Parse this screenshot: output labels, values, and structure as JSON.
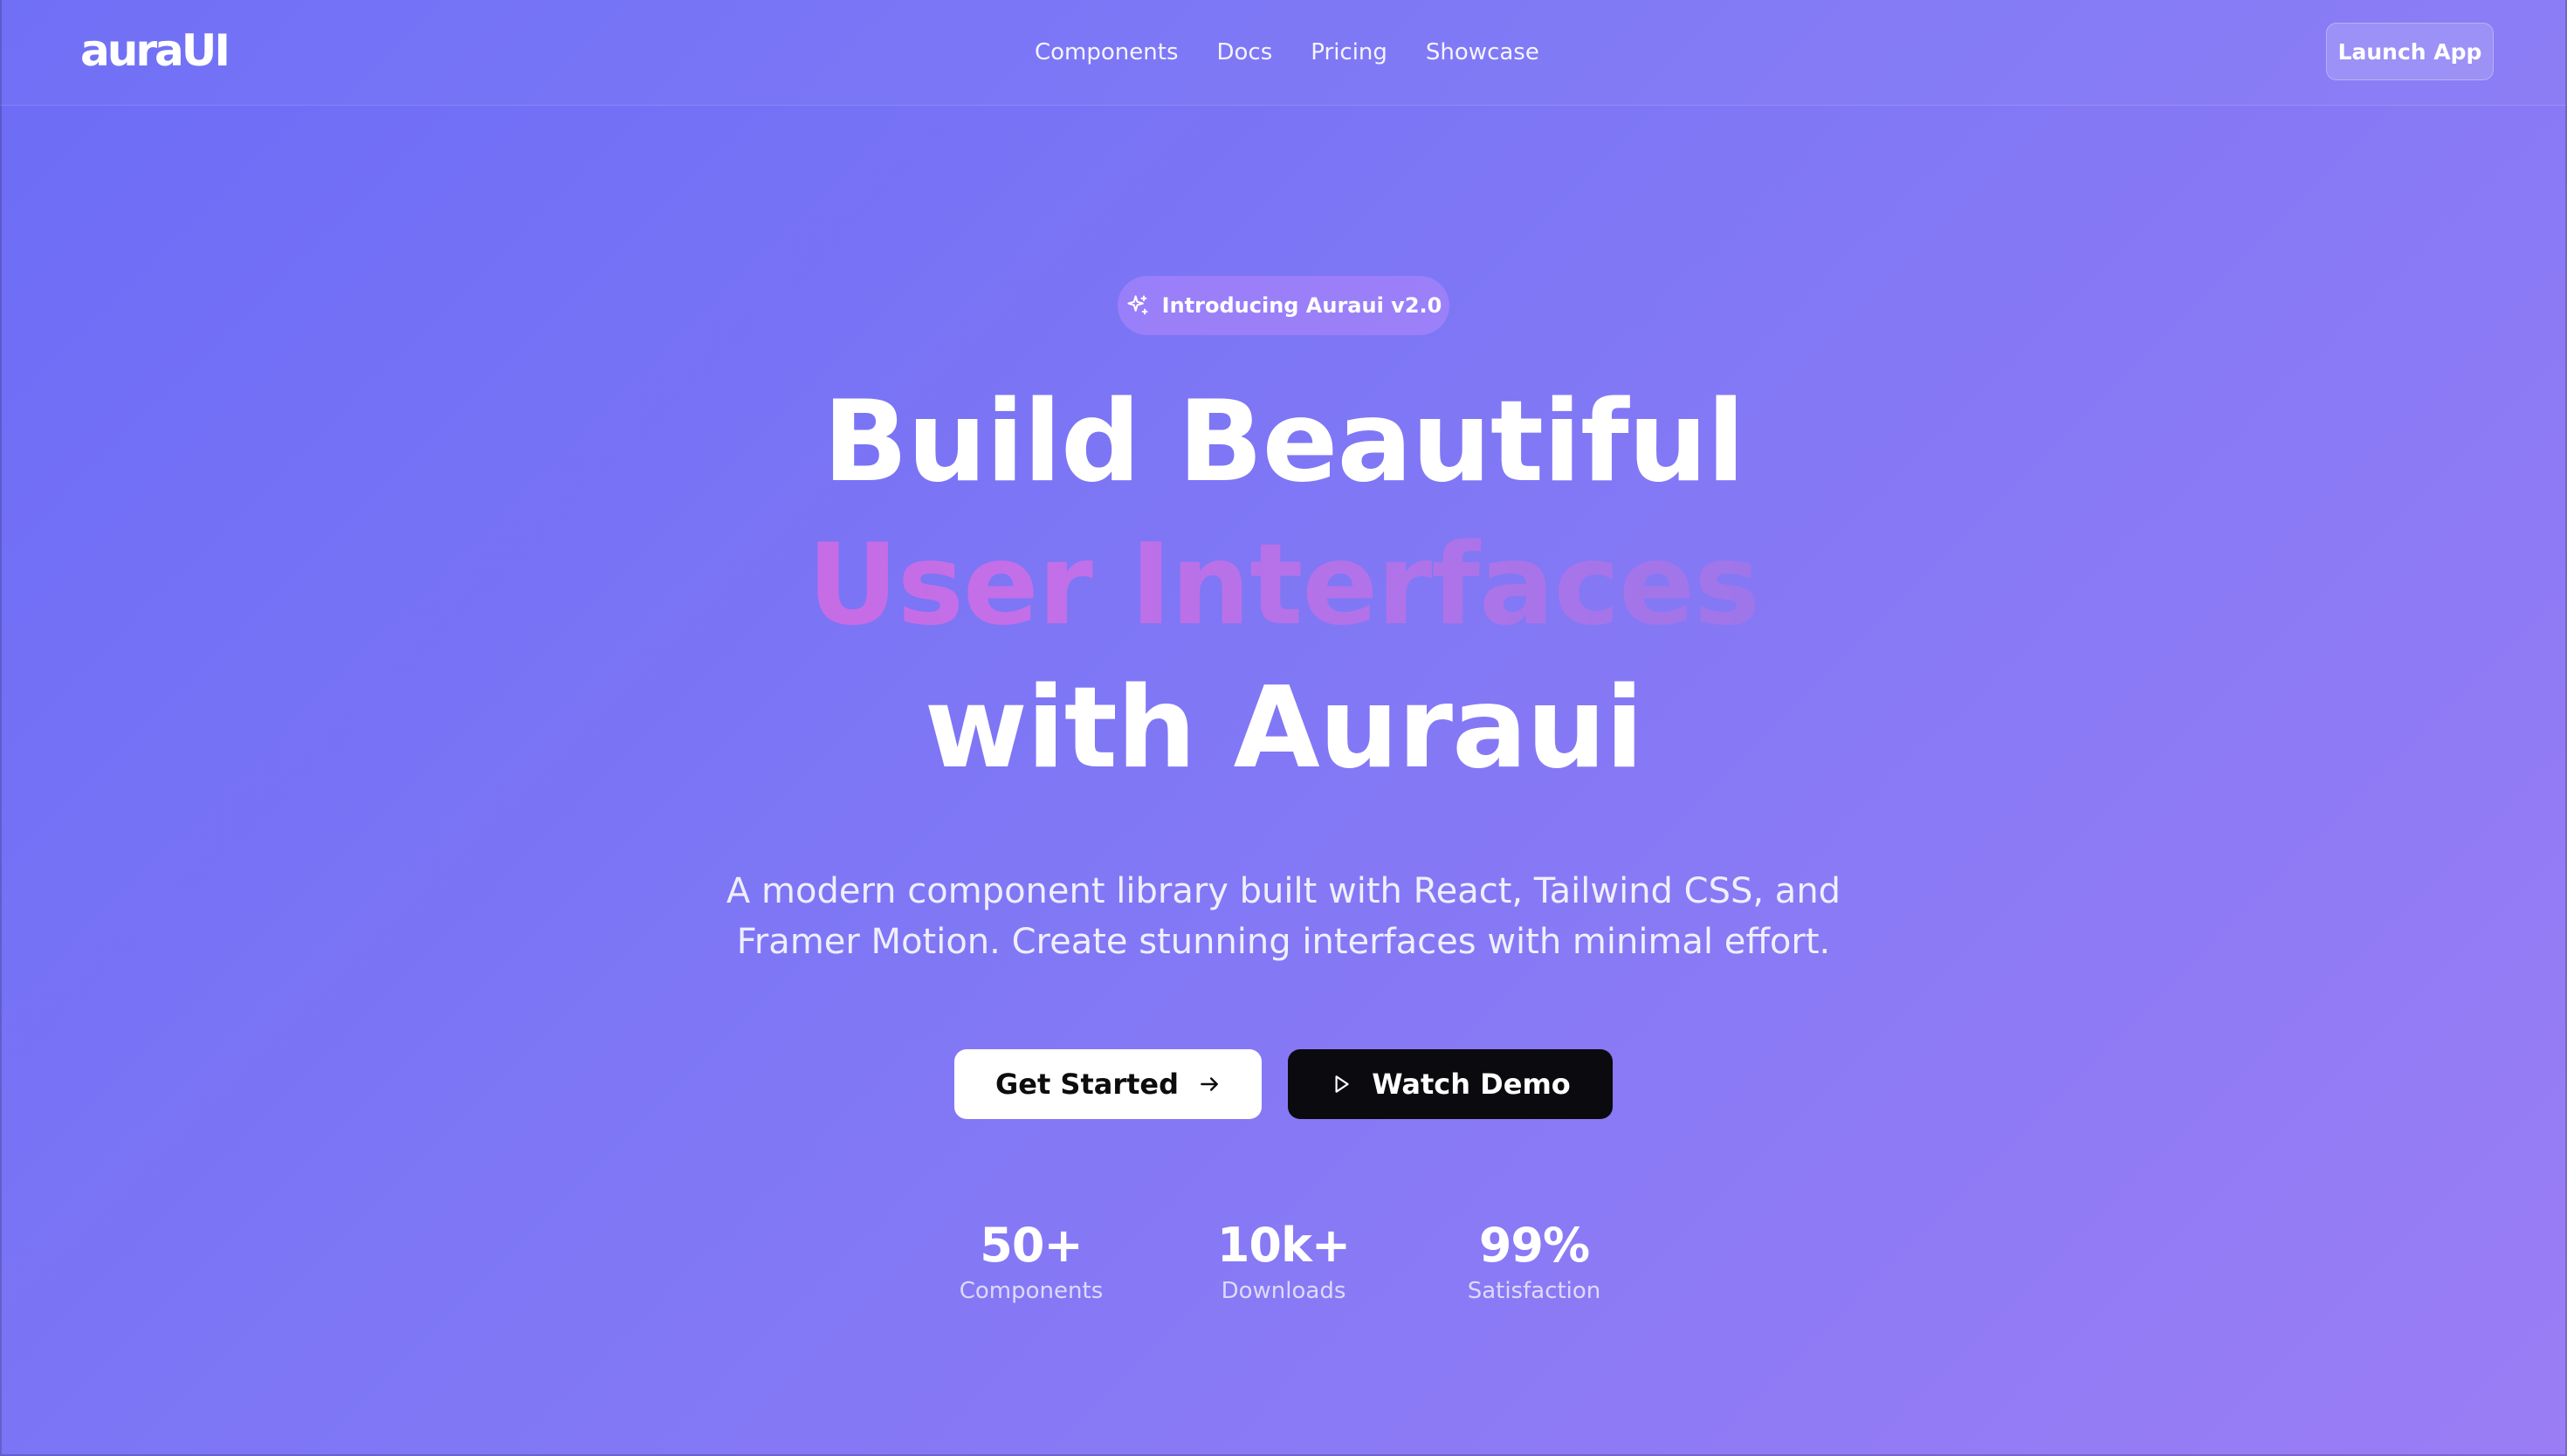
{
  "header": {
    "logo": "auraUI",
    "nav": [
      {
        "label": "Components"
      },
      {
        "label": "Docs"
      },
      {
        "label": "Pricing"
      },
      {
        "label": "Showcase"
      }
    ],
    "launch_label": "Launch App"
  },
  "hero": {
    "badge": {
      "icon": "sparkles-icon",
      "label": "Introducing Auraui v2.0"
    },
    "headline": {
      "line1": "Build Beautiful",
      "line2": "User Interfaces",
      "line3": "with Auraui"
    },
    "subtitle": "A modern component library built with React, Tailwind CSS, and Framer Motion. Create stunning interfaces with minimal effort.",
    "buttons": {
      "primary": {
        "label": "Get Started",
        "icon": "arrow-right-icon"
      },
      "secondary": {
        "label": "Watch Demo",
        "icon": "play-icon"
      }
    }
  },
  "stats": [
    {
      "value": "50+",
      "label": "Components"
    },
    {
      "value": "10k+",
      "label": "Downloads"
    },
    {
      "value": "99%",
      "label": "Satisfaction"
    }
  ],
  "colors": {
    "background_start": "#6c6cf6",
    "background_end": "#9a7df5",
    "gradient_text_start": "#d35fd8",
    "gradient_text_end": "#7a6de0",
    "primary_button_bg": "#ffffff",
    "secondary_button_bg": "#0b0b0f"
  }
}
